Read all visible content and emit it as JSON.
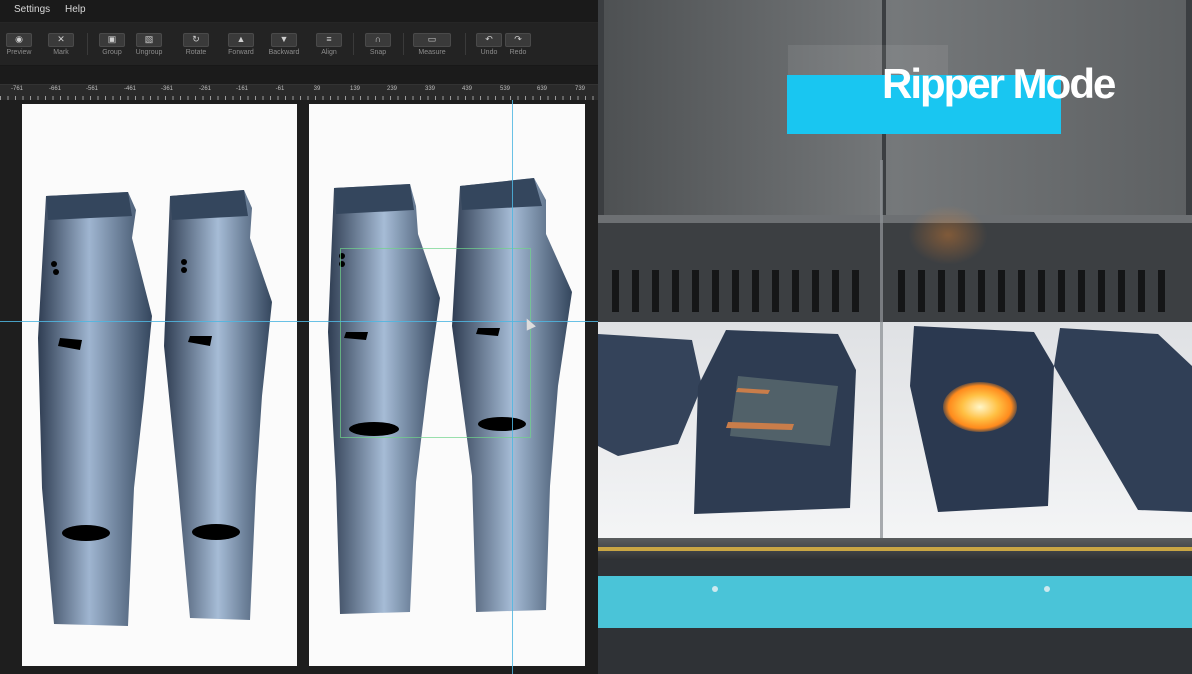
{
  "menu": {
    "items": [
      "Settings",
      "Help"
    ]
  },
  "toolbar": {
    "tools": [
      {
        "label": "Preview",
        "icon": "eye-icon"
      },
      {
        "label": "Mark",
        "icon": "mark-icon"
      },
      {
        "label": "Group",
        "icon": "group-icon"
      },
      {
        "label": "Ungroup",
        "icon": "ungroup-icon"
      },
      {
        "label": "Rotate",
        "icon": "rotate-icon"
      },
      {
        "label": "Forward",
        "icon": "bring-forward-icon"
      },
      {
        "label": "Backward",
        "icon": "send-backward-icon"
      },
      {
        "label": "Align",
        "icon": "align-icon"
      },
      {
        "label": "Snap",
        "icon": "magnet-icon"
      },
      {
        "label": "Measure",
        "icon": "ruler-icon"
      },
      {
        "label": "Undo",
        "icon": "undo-icon"
      },
      {
        "label": "Redo",
        "icon": "redo-icon"
      }
    ]
  },
  "ruler": {
    "labels": [
      "-761",
      "-661",
      "-561",
      "-461",
      "-361",
      "-261",
      "-161",
      "-61",
      "39",
      "139",
      "239",
      "339",
      "439",
      "539",
      "639",
      "739"
    ]
  },
  "video": {
    "overlay_title": "Ripper Mode"
  },
  "colors": {
    "accent_cyan": "#19c6f1",
    "guide_blue": "#4fb6e0",
    "denim": "#3d4f66"
  }
}
